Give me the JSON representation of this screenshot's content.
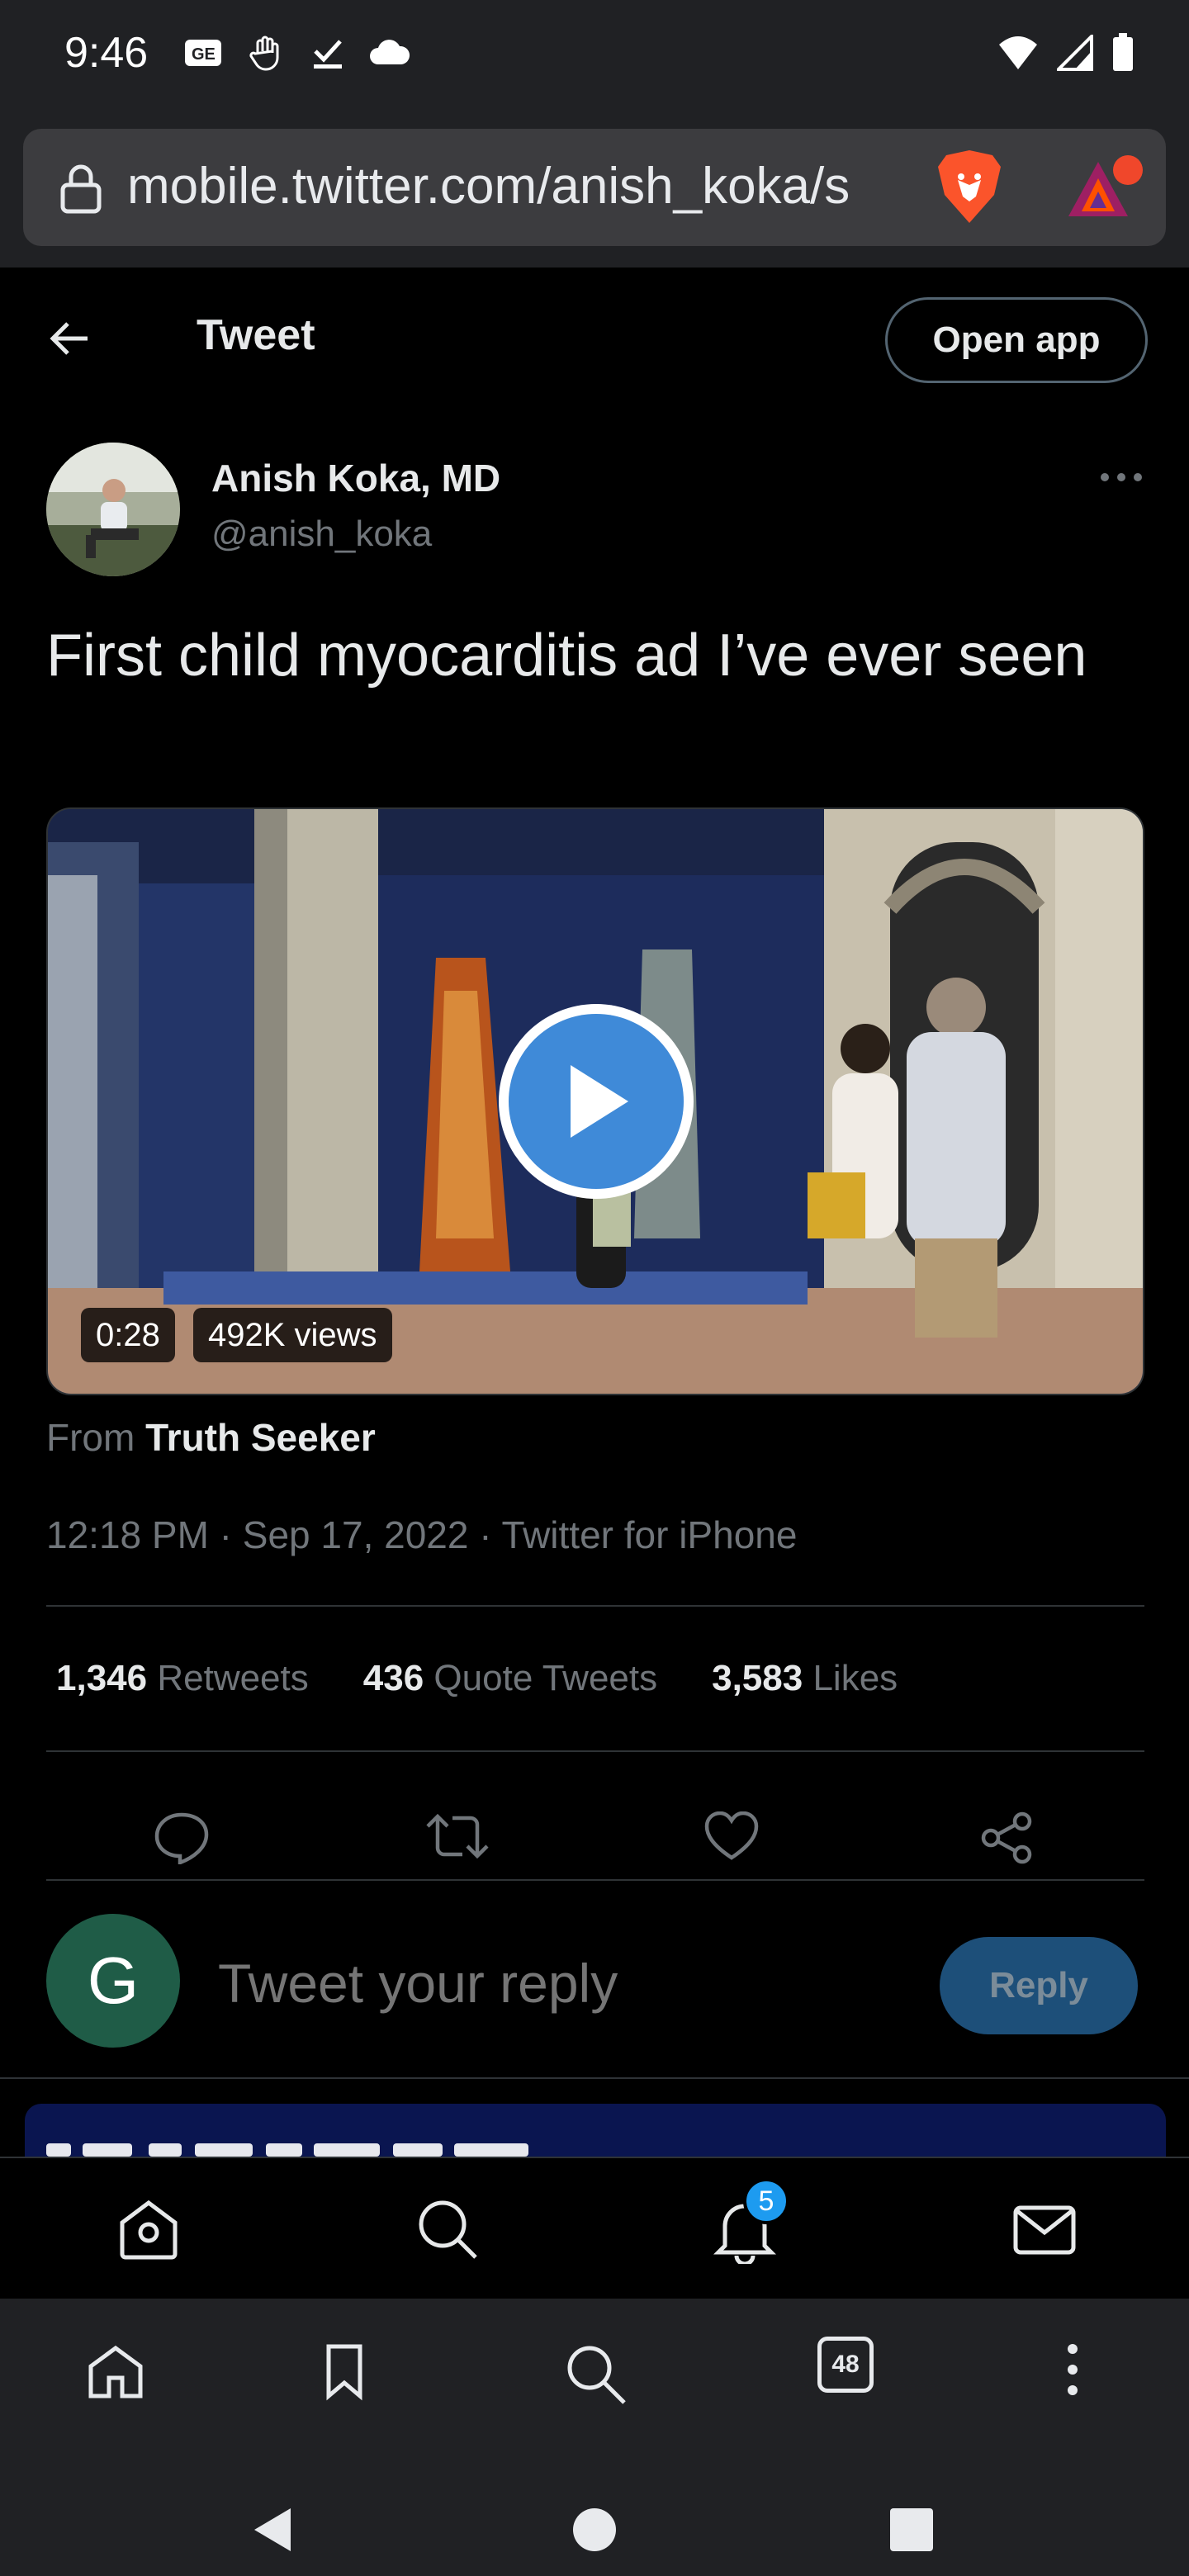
{
  "status_bar": {
    "time": "9:46"
  },
  "browser": {
    "url": "mobile.twitter.com/anish_koka/s"
  },
  "header": {
    "title": "Tweet",
    "open_app_label": "Open app"
  },
  "tweet": {
    "author_name": "Anish Koka, MD",
    "author_handle": "@anish_koka",
    "text": "First child myocarditis ad I’ve ever seen",
    "video": {
      "duration": "0:28",
      "views": "492K views"
    },
    "from_label": "From",
    "from_source": "Truth Seeker",
    "meta": "12:18 PM · Sep 17, 2022 · Twitter for iPhone",
    "stats": [
      {
        "count": "1,346",
        "label": "Retweets"
      },
      {
        "count": "436",
        "label": "Quote Tweets"
      },
      {
        "count": "3,583",
        "label": "Likes"
      }
    ]
  },
  "reply": {
    "avatar_letter": "G",
    "placeholder": "Tweet your reply",
    "button_label": "Reply"
  },
  "twitter_nav": {
    "notifications_badge": "5"
  },
  "browser_nav": {
    "tab_count": "48"
  },
  "colors": {
    "accent": "#1d9bf0",
    "reply_button": "#1d4f79",
    "background": "#000000"
  }
}
